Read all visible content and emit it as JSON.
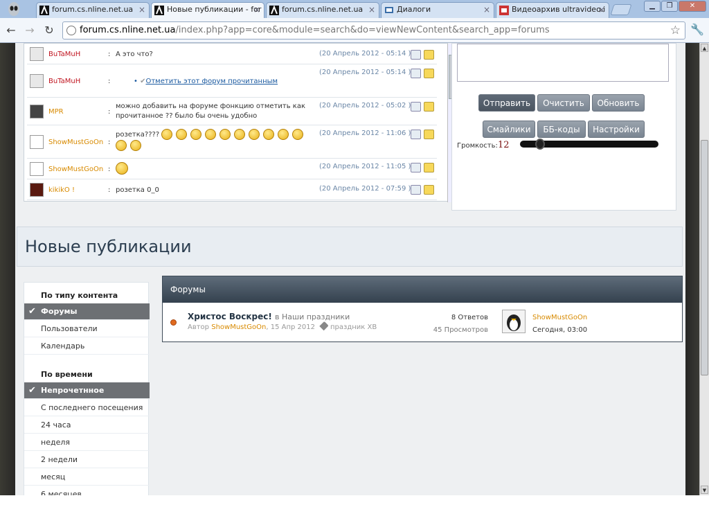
{
  "tabs": [
    {
      "title": "forum.cs.nline.net.ua",
      "close": "×"
    },
    {
      "title": "Новые публикации - for",
      "close": "×"
    },
    {
      "title": "forum.cs.nline.net.ua",
      "close": "×"
    },
    {
      "title": "Диалоги",
      "close": "×"
    },
    {
      "title": "Видеоархив ultravideo.i",
      "close": "×"
    }
  ],
  "nav": {
    "back": "←",
    "forward": "→",
    "reload": "↻",
    "url_host": "forum.cs.nline.net.ua",
    "url_path": "/index.php?app=core&module=search&do=viewNewContent&search_app=forums",
    "star": "☆",
    "wrench": "🔧"
  },
  "chat": {
    "rows": [
      {
        "nick": "BuTaMuH",
        "msg": "А это что?",
        "time": "(20 Апрель 2012 - 05:14 )"
      },
      {
        "nick": "BuTaMuH",
        "msg": "Отметить этот форум прочитанным",
        "time": "(20 Апрель 2012 - 05:14 )"
      },
      {
        "nick": "MPR",
        "msg": "можно добавить на форуме фонкцию отметить как прочитанное ?? было бы очень удобно",
        "time": "(20 Апрель 2012 - 05:02 )"
      },
      {
        "nick": "ShowMustGoOn",
        "msg": "розетка????",
        "time": "(20 Апрель 2012 - 11:06 )"
      },
      {
        "nick": "ShowMustGoOn",
        "msg": "",
        "time": "(20 Апрель 2012 - 11:05 )"
      },
      {
        "nick": "kikikO !",
        "msg": "розетка 0_0",
        "time": "(20 Апрель 2012 - 07:59 )"
      }
    ],
    "colon": ":",
    "bullet": "•"
  },
  "controls": {
    "send": "Отправить",
    "clear": "Очистить",
    "refresh": "Обновить",
    "smileys": "Смайлики",
    "bbcodes": "ББ-коды",
    "settings": "Настройки",
    "volume_label": "Громкость:",
    "volume": "12",
    "volume_level": 0.12
  },
  "page_title": "Новые публикации",
  "filters": {
    "content_heading": "По типу контента",
    "content": [
      {
        "label": "Форумы",
        "selected": true
      },
      {
        "label": "Пользователи"
      },
      {
        "label": "Календарь"
      }
    ],
    "time_heading": "По времени",
    "time": [
      {
        "label": "Непрочетнное",
        "selected": true
      },
      {
        "label": "С последнего посещения"
      },
      {
        "label": "24 часа"
      },
      {
        "label": "неделя"
      },
      {
        "label": "2 недели"
      },
      {
        "label": "месяц"
      },
      {
        "label": "6 месяцев"
      }
    ],
    "check": "✔"
  },
  "results": {
    "heading": "Форумы",
    "item": {
      "title": "Христос Воскрес!",
      "in_label": "в",
      "forum": "Наши праздники",
      "author_label": "Автор",
      "author": "ShowMustGoOn",
      "date": ", 15 Апр 2012",
      "tag": "праздник ХВ",
      "replies": "8 Ответов",
      "views": "45 Просмотров",
      "last_user": "ShowMustGoOn",
      "last_time": "Сегодня, 03:00"
    }
  },
  "window": {
    "minimize": "▁",
    "maximize": "❐",
    "close": "✕"
  },
  "colors": {
    "accent": "#d88a00",
    "nick_red": "#c0141f",
    "selected_filter": "#6d7074"
  }
}
